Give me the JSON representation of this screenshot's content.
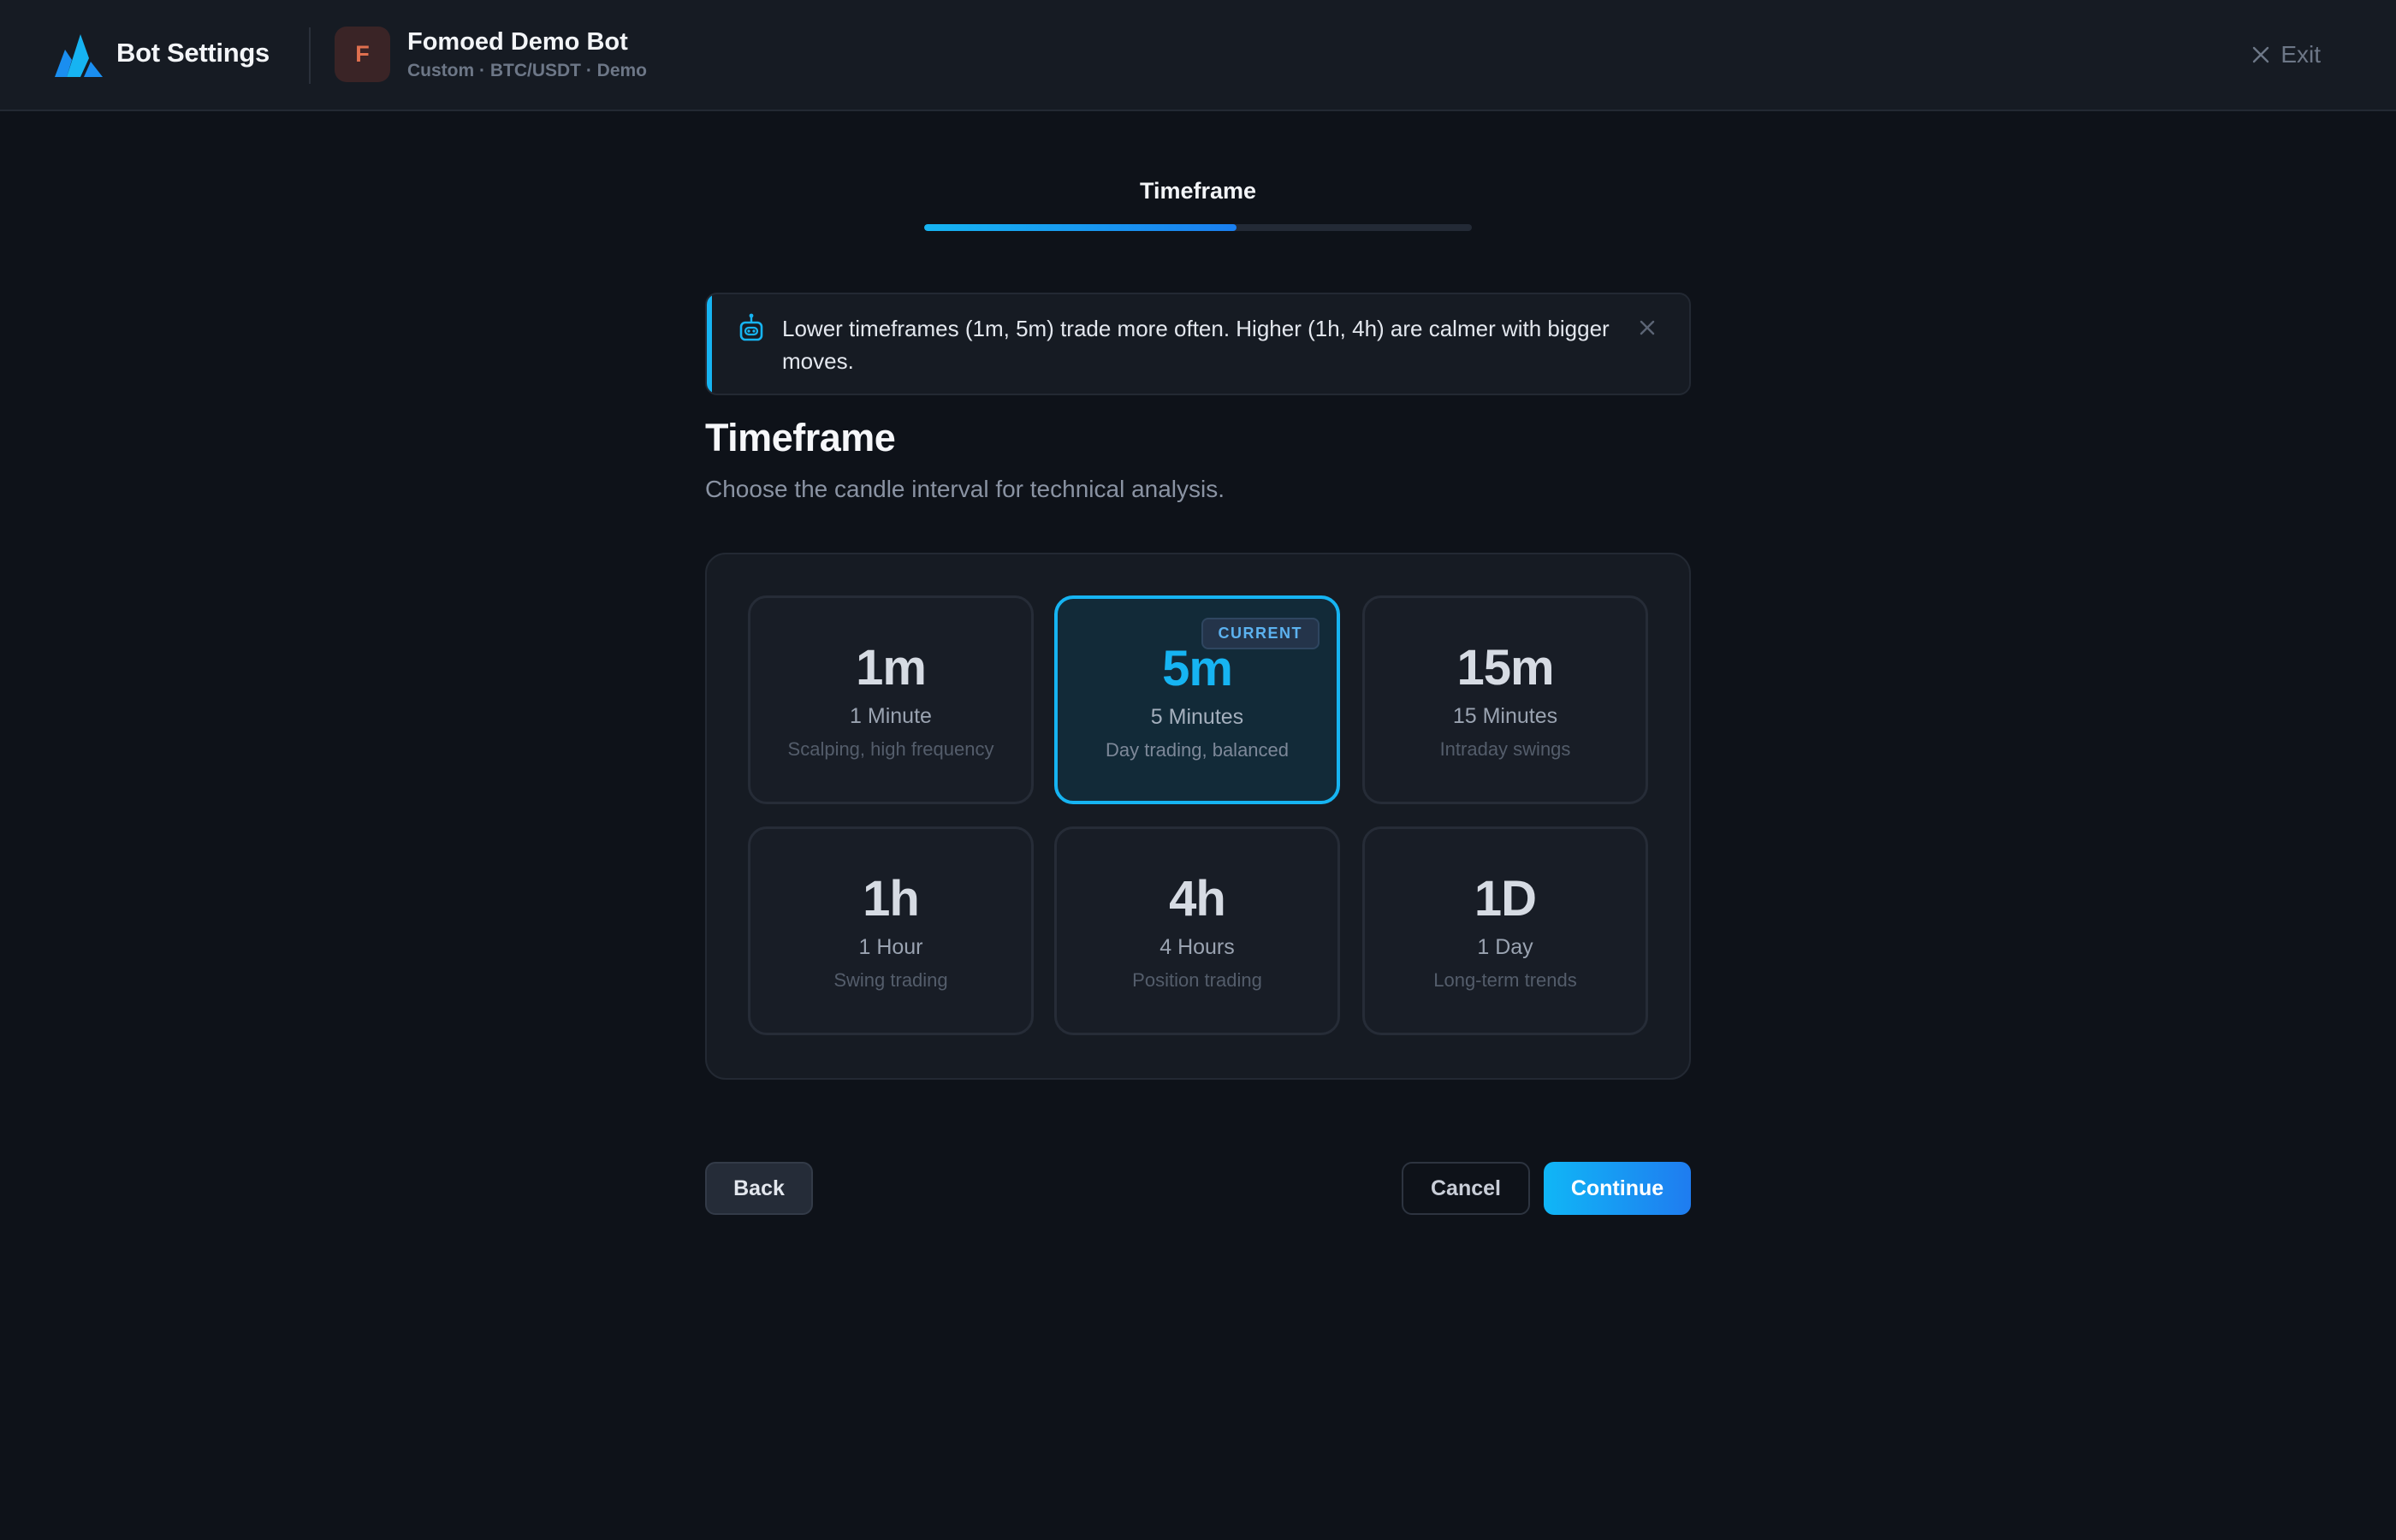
{
  "header": {
    "app_title": "Bot Settings",
    "bot_initial": "F",
    "bot_name": "Fomoed Demo Bot",
    "bot_meta": "Custom · BTC/USDT · Demo",
    "exit_label": "Exit"
  },
  "step": {
    "label": "Timeframe",
    "progress": 0.57
  },
  "banner": {
    "icon": "robot-icon",
    "text": "Lower timeframes (1m, 5m) trade more often. Higher (1h, 4h) are calmer with bigger moves."
  },
  "section": {
    "title": "Timeframe",
    "subtitle": "Choose the candle interval for technical analysis."
  },
  "options": [
    {
      "value": "1m",
      "name": "1 Minute",
      "desc": "Scalping, high frequency",
      "selected": false
    },
    {
      "value": "5m",
      "name": "5 Minutes",
      "desc": "Day trading, balanced",
      "selected": true,
      "badge": "CURRENT"
    },
    {
      "value": "15m",
      "name": "15 Minutes",
      "desc": "Intraday swings",
      "selected": false
    },
    {
      "value": "1h",
      "name": "1 Hour",
      "desc": "Swing trading",
      "selected": false
    },
    {
      "value": "4h",
      "name": "4 Hours",
      "desc": "Position trading",
      "selected": false
    },
    {
      "value": "1D",
      "name": "1 Day",
      "desc": "Long-term trends",
      "selected": false
    }
  ],
  "footer": {
    "back_label": "Back",
    "cancel_label": "Cancel",
    "continue_label": "Continue"
  },
  "colors": {
    "accent": "#16b4f2",
    "background": "#0e1219",
    "surface": "#161b23",
    "avatar_text": "#e0704f"
  }
}
